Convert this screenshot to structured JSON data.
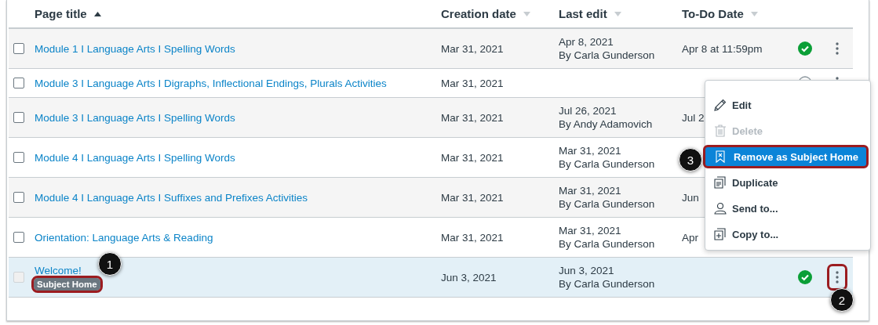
{
  "columns": [
    {
      "label": "Page title",
      "sorted": true
    },
    {
      "label": "Creation date",
      "sorted": false
    },
    {
      "label": "Last edit",
      "sorted": false
    },
    {
      "label": "To-Do Date",
      "sorted": false
    }
  ],
  "rows": [
    {
      "title": "Module 1 I Language Arts I Spelling Words",
      "created": "Mar 31, 2021",
      "edited": "Apr 8, 2021",
      "edited_by": "By Carla Gunderson",
      "todo": "Apr 8 at 11:59pm",
      "published": true,
      "selected": false,
      "checkbox_disabled": false,
      "menu_highlighted": false
    },
    {
      "title": "Module 3 I Language Arts I Digraphs, Inflectional Endings, Plurals Activities",
      "created": "Mar 31, 2021",
      "published": false,
      "selected": false,
      "checkbox_disabled": false,
      "menu_highlighted": false
    },
    {
      "title": "Module 3 I Language Arts I Spelling Words",
      "created": "Mar 31, 2021",
      "edited": "Jul 26, 2021",
      "edited_by": "By Andy Adamovich",
      "todo": "Jul 2",
      "selected": false,
      "checkbox_disabled": false
    },
    {
      "title": "Module 4 I Language Arts I Spelling Words",
      "created": "Mar 31, 2021",
      "edited": "Mar 31, 2021",
      "edited_by": "By Carla Gunderson",
      "selected": false,
      "checkbox_disabled": false
    },
    {
      "title": "Module 4 I Language Arts I Suffixes and Prefixes Activities",
      "created": "Mar 31, 2021",
      "edited": "Mar 31, 2021",
      "edited_by": "By Carla Gunderson",
      "todo": "Jun",
      "selected": false,
      "checkbox_disabled": false
    },
    {
      "title": "Orientation: Language Arts & Reading",
      "created": "Mar 31, 2021",
      "edited": "Mar 31, 2021",
      "edited_by": "By Carla Gunderson",
      "todo": "Apr",
      "selected": false,
      "checkbox_disabled": false
    },
    {
      "title": "Welcome!",
      "badge": "Subject Home",
      "badge_highlighted": true,
      "created": "Jun 3, 2021",
      "edited": "Jun 3, 2021",
      "edited_by": "By Carla Gunderson",
      "published": true,
      "selected": true,
      "checkbox_disabled": true,
      "menu_highlighted": true
    }
  ],
  "menu": [
    {
      "label": "Edit",
      "disabled": false,
      "selected": false
    },
    {
      "label": "Delete",
      "disabled": true,
      "selected": false
    },
    {
      "label": "Remove as Subject Home",
      "disabled": false,
      "selected": true
    },
    {
      "label": "Duplicate",
      "disabled": false,
      "selected": false
    },
    {
      "label": "Send to...",
      "disabled": false,
      "selected": false
    },
    {
      "label": "Copy to...",
      "disabled": false,
      "selected": false
    }
  ],
  "callouts": [
    "1",
    "2",
    "3"
  ]
}
